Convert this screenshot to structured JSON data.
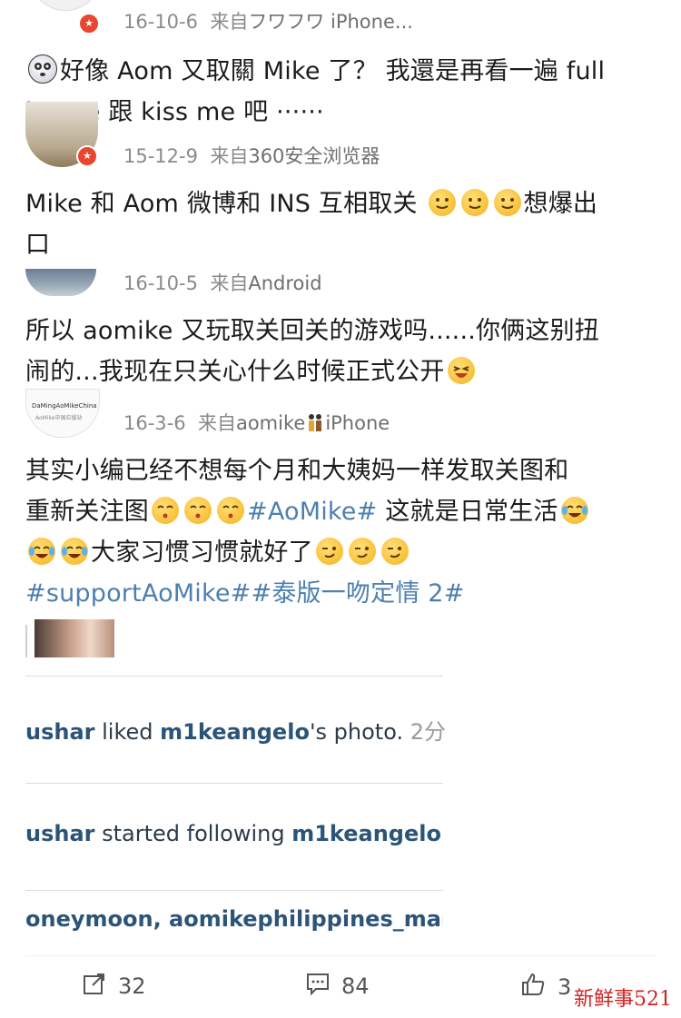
{
  "comments": [
    {
      "date": "16-10-6",
      "source_prefix": "来自",
      "source": "フワフワ iPhone..."
    },
    {
      "date": "15-12-9",
      "source_prefix": "来自",
      "source": "360安全浏览器"
    },
    {
      "date": "16-10-5",
      "source_prefix": "来自",
      "source": "Android"
    },
    {
      "date": "16-3-6",
      "source_prefix": "来自",
      "source": "aomike",
      "source_suffix": "iPhone",
      "avatar_text": "DaMingAoMikeChina",
      "avatar_subtext": "AoMike中国应援站"
    }
  ],
  "posts": {
    "p1_a": "好像 Aom 又取關 Mike 了？ 我還是再看一遍 full",
    "p1_b": "house 跟 kiss me 吧 ······",
    "p2_a": "Mike 和 Aom 微博和 INS 互相取关",
    "p2_b": "想爆出",
    "p2_c": "口",
    "p3_a": "所以 aomike 又玩取关回关的游戏吗......你俩这别扭",
    "p3_b": "闹的...我现在只关心什么时候正式公开",
    "p4_a": "其实小编已经不想每个月和大姨妈一样发取关图和",
    "p4_b": "重新关注图",
    "p4_tag1": "#AoMike#",
    "p4_c": " 这就是日常生活",
    "p4_d": "大家习惯习惯就好了",
    "p4_tags": "#supportAoMike##泰版一吻定情 2#"
  },
  "instagram": {
    "line1_user": "ushar",
    "line1_action": "liked",
    "line1_target": "m1keangelo",
    "line1_suffix": "'s photo.",
    "line1_time": "2分",
    "line2_user": "ushar",
    "line2_action": "started following",
    "line2_target": "m1keangelo",
    "line3": "oneymoon, aomikephilippines_mary"
  },
  "footer": {
    "repost_count": "32",
    "comment_count": "84",
    "like_count": "3"
  },
  "watermark": "新鲜事521",
  "colors": {
    "tag": "#4d7fb0",
    "meta": "#8a8a8a",
    "vip_badge": "#e8462e",
    "watermark": "#d0231f"
  }
}
